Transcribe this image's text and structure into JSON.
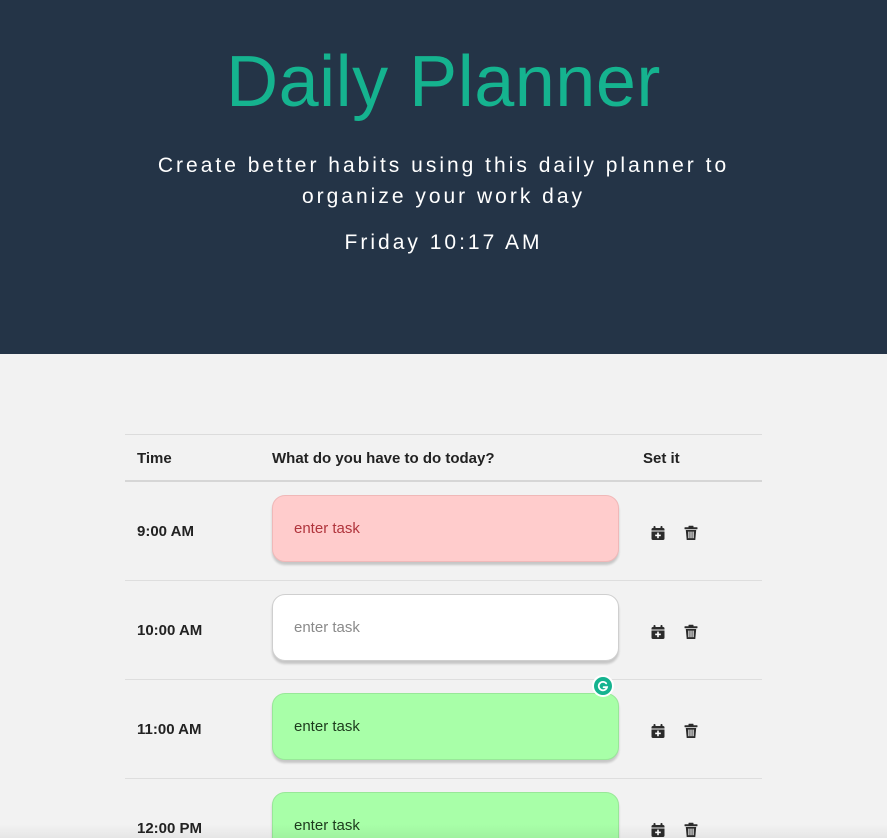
{
  "header": {
    "title": "Daily Planner",
    "lead": "Create better habits using this daily planner to organize your work day",
    "current_time": "Friday 10:17 AM"
  },
  "table": {
    "headers": {
      "time": "Time",
      "task": "What do you have to do today?",
      "set": "Set it"
    },
    "rows": [
      {
        "hour": "9:00 AM",
        "task_value": "",
        "task_placeholder": "enter task",
        "state": "past"
      },
      {
        "hour": "10:00 AM",
        "task_value": "",
        "task_placeholder": "enter task",
        "state": "present"
      },
      {
        "hour": "11:00 AM",
        "task_value": "",
        "task_placeholder": "enter task",
        "state": "future"
      },
      {
        "hour": "12:00 PM",
        "task_value": "",
        "task_placeholder": "enter task",
        "state": "future"
      }
    ]
  },
  "icons": {
    "save": "calendar-plus-icon",
    "delete": "trash-icon",
    "extension": "grammarly-icon"
  },
  "colors": {
    "header_bg": "#243447",
    "title": "#15b38f",
    "past": "#ffcccc",
    "present": "#ffffff",
    "future": "#a8ffa8",
    "page_bg": "#f2f2f2"
  }
}
